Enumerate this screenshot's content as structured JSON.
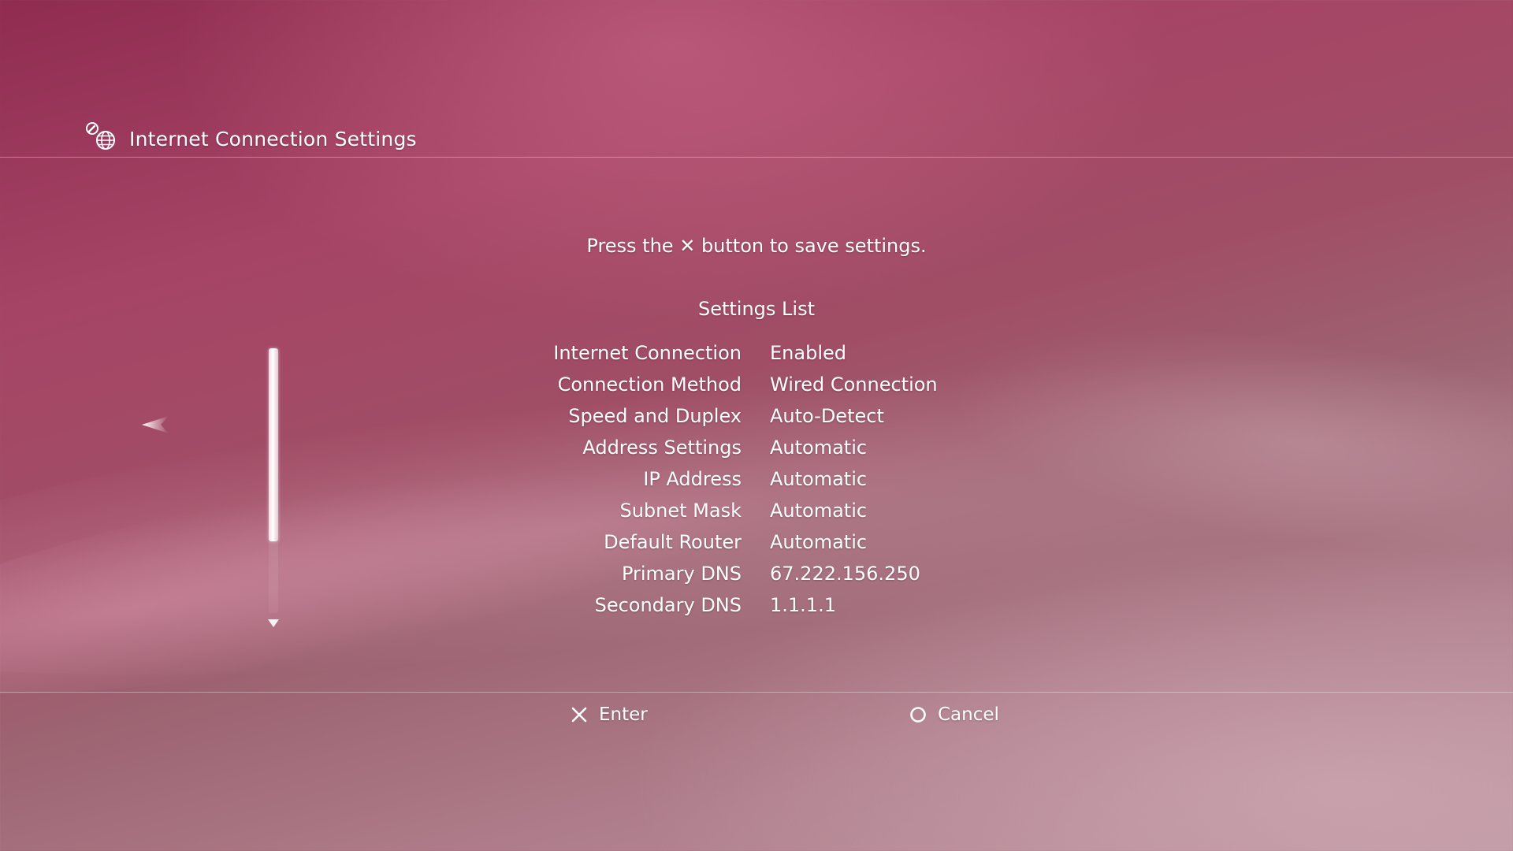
{
  "header": {
    "title": "Internet Connection Settings",
    "icon": "network-settings-icon"
  },
  "instruction": {
    "text": "Press the ✕ button to save settings."
  },
  "settings_list": {
    "title": "Settings List",
    "rows": [
      {
        "label": "Internet Connection",
        "value": "Enabled"
      },
      {
        "label": "Connection Method",
        "value": "Wired Connection"
      },
      {
        "label": "Speed and Duplex",
        "value": "Auto-Detect"
      },
      {
        "label": "Address Settings",
        "value": "Automatic"
      },
      {
        "label": "IP Address",
        "value": "Automatic"
      },
      {
        "label": "Subnet Mask",
        "value": "Automatic"
      },
      {
        "label": "Default Router",
        "value": "Automatic"
      },
      {
        "label": "Primary DNS",
        "value": "67.222.156.250"
      },
      {
        "label": "Secondary DNS",
        "value": "1.1.1.1"
      }
    ]
  },
  "scrollbar": {
    "visible_fraction": 0.73,
    "position_fraction": 0
  },
  "footer": {
    "enter_label": "Enter",
    "enter_icon": "cross-button-icon",
    "cancel_label": "Cancel",
    "cancel_icon": "circle-button-icon"
  },
  "colors": {
    "theme_background": "#a64466",
    "text": "#ffffff"
  }
}
